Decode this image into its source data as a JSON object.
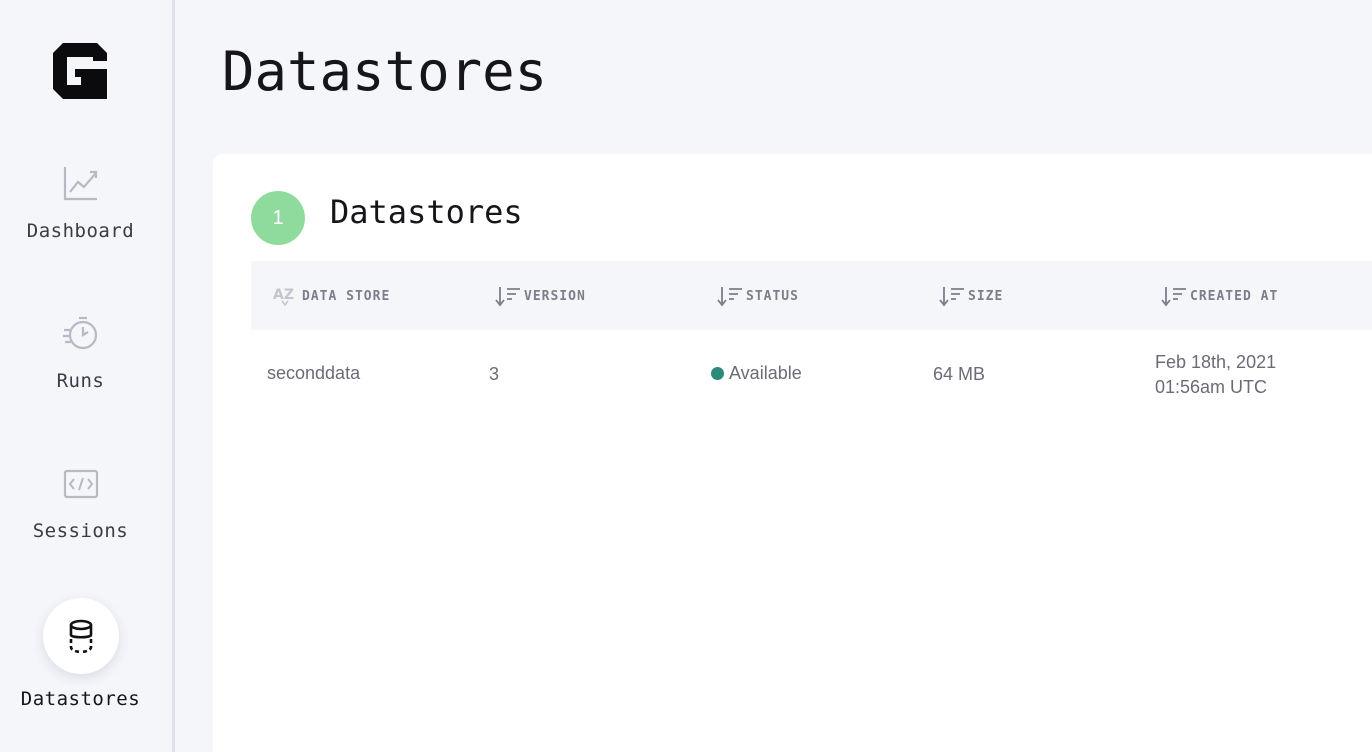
{
  "sidebar": {
    "items": [
      {
        "label": "Dashboard",
        "icon": "chart-line-icon"
      },
      {
        "label": "Runs",
        "icon": "runs-stopwatch-icon"
      },
      {
        "label": "Sessions",
        "icon": "code-window-icon"
      },
      {
        "label": "Datastores",
        "icon": "database-icon",
        "active": true
      }
    ]
  },
  "header": {
    "title": "Datastores"
  },
  "main": {
    "step_number": "1",
    "section_title": "Datastores",
    "columns": [
      "Data Store",
      "Version",
      "Status",
      "Size",
      "Created At"
    ],
    "rows": [
      {
        "data_store": "seconddata",
        "version": "3",
        "status": "Available",
        "size": "64 MB",
        "created_date": "Feb 18th, 2021",
        "created_time": "01:56am UTC"
      }
    ]
  },
  "colors": {
    "background": "#f5f6fa",
    "card": "#ffffff",
    "step_badge": "#8fdb9e",
    "status_available": "#2b8a7a"
  }
}
